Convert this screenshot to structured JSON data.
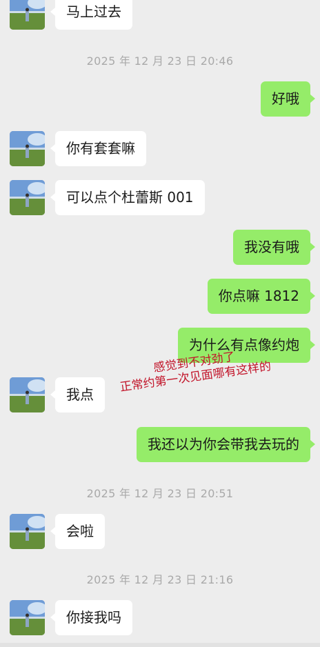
{
  "chat": {
    "messages": [
      {
        "side": "in",
        "text": "马上过去"
      },
      {
        "side": "time",
        "text": "2025 年 12 月 23 日 20:46"
      },
      {
        "side": "out",
        "text": "好哦"
      },
      {
        "side": "in",
        "text": "你有套套嘛"
      },
      {
        "side": "in",
        "text": "可以点个杜蕾斯 001"
      },
      {
        "side": "out",
        "text": "我没有哦"
      },
      {
        "side": "out",
        "text": "你点嘛 1812"
      },
      {
        "side": "out",
        "text": "为什么有点像约炮"
      },
      {
        "side": "in",
        "text": "我点"
      },
      {
        "side": "out",
        "text": "我还以为你会带我去玩的"
      },
      {
        "side": "time",
        "text": "2025 年 12 月 23 日 20:51"
      },
      {
        "side": "in",
        "text": "会啦"
      },
      {
        "side": "time",
        "text": "2025 年 12 月 23 日 21:16"
      },
      {
        "side": "in",
        "text": "你接我吗"
      }
    ]
  },
  "annotation": {
    "line1": "感觉到不对劲了",
    "line2": "正常约第一次见面哪有这样的",
    "color": "#c2152a"
  },
  "colors": {
    "background": "#ededed",
    "incoming_bubble": "#ffffff",
    "outgoing_bubble": "#95ec69",
    "timestamp_text": "#a9a9a9"
  },
  "icons": {
    "contact_avatar": "avatar-icon"
  }
}
